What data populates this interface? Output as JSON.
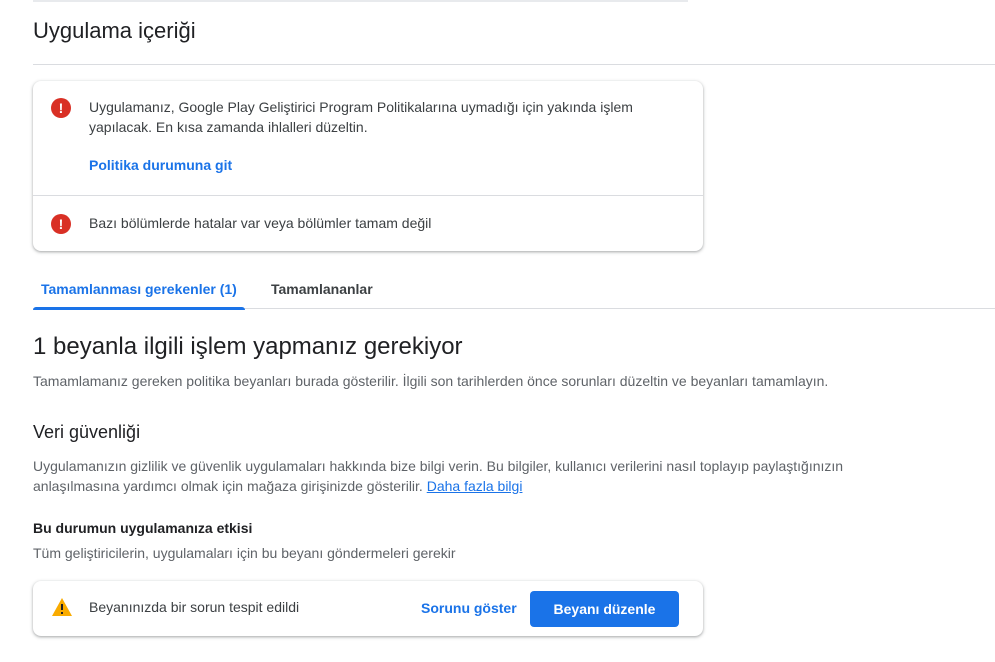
{
  "page": {
    "title": "Uygulama içeriği"
  },
  "alerts": {
    "policy_warning": "Uygulamanız, Google Play Geliştirici Program Politikalarına uymadığı için yakında işlem yapılacak. En kısa zamanda ihlalleri düzeltin.",
    "policy_link": "Politika durumuna git",
    "sections_warning": "Bazı bölümlerde hatalar var veya bölümler tamam değil",
    "icon": "error-icon"
  },
  "tabs": [
    {
      "label": "Tamamlanması gerekenler (1)",
      "active": true
    },
    {
      "label": "Tamamlananlar",
      "active": false
    }
  ],
  "main": {
    "heading": "1 beyanla ilgili işlem yapmanız gerekiyor",
    "description": "Tamamlamanız gereken politika beyanları burada gösterilir. İlgili son tarihlerden önce sorunları düzeltin ve beyanları tamamlayın."
  },
  "data_safety": {
    "title": "Veri güvenliği",
    "description": "Uygulamanızın gizlilik ve güvenlik uygulamaları hakkında bize bilgi verin. Bu bilgiler, kullanıcı verilerini nasıl toplayıp paylaştığınızın anlaşılmasına yardımcı olmak için mağaza girişinizde gösterilir.",
    "learn_more": "Daha fazla bilgi",
    "impact_title": "Bu durumun uygulamanıza etkisi",
    "impact_description": "Tüm geliştiricilerin, uygulamaları için bu beyanı göndermeleri gerekir"
  },
  "issue": {
    "text": "Beyanınızda bir sorun tespit edildi",
    "show_issue_label": "Sorunu göster",
    "edit_button_label": "Beyanı düzenle",
    "icon": "warning-icon"
  },
  "colors": {
    "accent": "#1a73e8",
    "error": "#d93025",
    "warning": "#f9ab00"
  }
}
